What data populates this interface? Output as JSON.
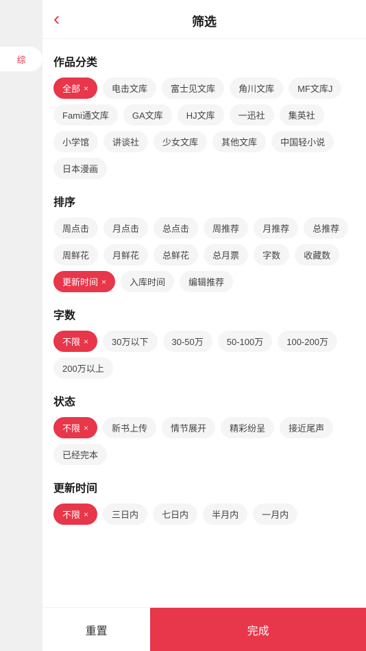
{
  "header": {
    "title": "筛选",
    "back_label": "‹"
  },
  "sidebar": {
    "active_tab": "综"
  },
  "sections": {
    "category": {
      "title": "作品分类",
      "tags": [
        {
          "label": "全部",
          "active": true,
          "closable": true
        },
        {
          "label": "电击文库",
          "active": false,
          "closable": false
        },
        {
          "label": "富士见文库",
          "active": false,
          "closable": false
        },
        {
          "label": "角川文库",
          "active": false,
          "closable": false
        },
        {
          "label": "MF文库J",
          "active": false,
          "closable": false
        },
        {
          "label": "Fami通文库",
          "active": false,
          "closable": false
        },
        {
          "label": "GA文库",
          "active": false,
          "closable": false
        },
        {
          "label": "HJ文库",
          "active": false,
          "closable": false
        },
        {
          "label": "一迅社",
          "active": false,
          "closable": false
        },
        {
          "label": "集英社",
          "active": false,
          "closable": false
        },
        {
          "label": "小学馆",
          "active": false,
          "closable": false
        },
        {
          "label": "讲谈社",
          "active": false,
          "closable": false
        },
        {
          "label": "少女文库",
          "active": false,
          "closable": false
        },
        {
          "label": "其他文库",
          "active": false,
          "closable": false
        },
        {
          "label": "中国轻小说",
          "active": false,
          "closable": false
        },
        {
          "label": "日本漫画",
          "active": false,
          "closable": false
        }
      ]
    },
    "sort": {
      "title": "排序",
      "tags": [
        {
          "label": "周点击",
          "active": false,
          "closable": false
        },
        {
          "label": "月点击",
          "active": false,
          "closable": false
        },
        {
          "label": "总点击",
          "active": false,
          "closable": false
        },
        {
          "label": "周推荐",
          "active": false,
          "closable": false
        },
        {
          "label": "月推荐",
          "active": false,
          "closable": false
        },
        {
          "label": "总推荐",
          "active": false,
          "closable": false
        },
        {
          "label": "周鲜花",
          "active": false,
          "closable": false
        },
        {
          "label": "月鲜花",
          "active": false,
          "closable": false
        },
        {
          "label": "总鲜花",
          "active": false,
          "closable": false
        },
        {
          "label": "总月票",
          "active": false,
          "closable": false
        },
        {
          "label": "字数",
          "active": false,
          "closable": false
        },
        {
          "label": "收藏数",
          "active": false,
          "closable": false
        },
        {
          "label": "更新时间",
          "active": true,
          "closable": true
        },
        {
          "label": "入库时间",
          "active": false,
          "closable": false
        },
        {
          "label": "编辑推荐",
          "active": false,
          "closable": false
        }
      ]
    },
    "wordcount": {
      "title": "字数",
      "tags": [
        {
          "label": "不限",
          "active": true,
          "closable": true
        },
        {
          "label": "30万以下",
          "active": false,
          "closable": false
        },
        {
          "label": "30-50万",
          "active": false,
          "closable": false
        },
        {
          "label": "50-100万",
          "active": false,
          "closable": false
        },
        {
          "label": "100-200万",
          "active": false,
          "closable": false
        },
        {
          "label": "200万以上",
          "active": false,
          "closable": false
        }
      ]
    },
    "status": {
      "title": "状态",
      "tags": [
        {
          "label": "不限",
          "active": true,
          "closable": true
        },
        {
          "label": "新书上传",
          "active": false,
          "closable": false
        },
        {
          "label": "情节展开",
          "active": false,
          "closable": false
        },
        {
          "label": "精彩纷呈",
          "active": false,
          "closable": false
        },
        {
          "label": "接近尾声",
          "active": false,
          "closable": false
        },
        {
          "label": "已经完本",
          "active": false,
          "closable": false
        }
      ]
    },
    "update_time": {
      "title": "更新时间",
      "tags": [
        {
          "label": "不限",
          "active": true,
          "closable": true
        },
        {
          "label": "三日内",
          "active": false,
          "closable": false
        },
        {
          "label": "七日内",
          "active": false,
          "closable": false
        },
        {
          "label": "半月内",
          "active": false,
          "closable": false
        },
        {
          "label": "一月内",
          "active": false,
          "closable": false
        }
      ]
    }
  },
  "footer": {
    "reset_label": "重置",
    "confirm_label": "完成"
  }
}
